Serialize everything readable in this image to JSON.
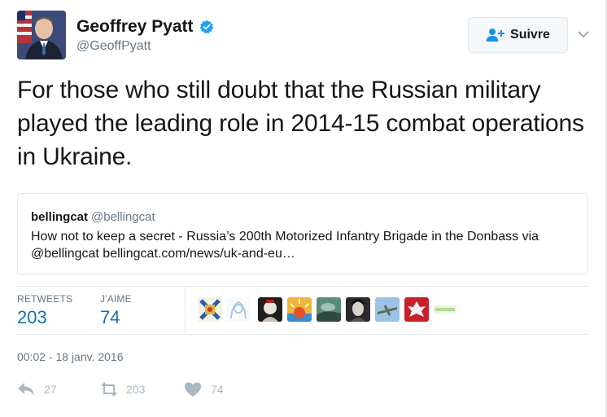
{
  "author": {
    "display_name": "Geoffrey Pyatt",
    "handle": "@GeoffPyatt",
    "verified": true
  },
  "follow_button": {
    "label": "Suivre",
    "icon": "add-user-icon"
  },
  "tweet": {
    "text": "For those who still doubt that the Russian military played the leading role in 2014-15 combat operations in Ukraine."
  },
  "quoted_tweet": {
    "name": "bellingcat",
    "handle": "@bellingcat",
    "text": "How not to keep a secret - Russia’s 200th Motorized Infantry Brigade in the Donbass via @bellingcat bellingcat.com/news/uk-and-eu…"
  },
  "stats": {
    "retweets_label": "RETWEETS",
    "retweets_value": "203",
    "likes_label": "J'AIME",
    "likes_value": "74"
  },
  "timestamp": "00:02 - 18 janv. 2016",
  "actions": {
    "reply_count": "27",
    "retweet_count": "203",
    "like_count": "74"
  },
  "colors": {
    "link_blue": "#1b6ea8",
    "verified_blue": "#1da1f2",
    "muted_text": "#657786",
    "border": "#e1e8ed",
    "action_gray": "#aab8c2"
  }
}
